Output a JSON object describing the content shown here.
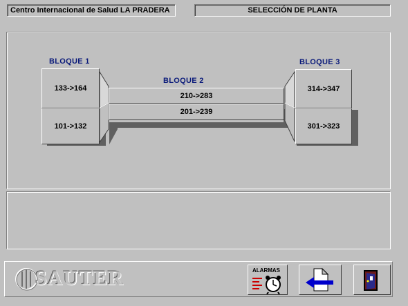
{
  "header": {
    "site_title": "Centro Internacional de Salud  LA PRADERA",
    "screen_title": "SELECCIÓN DE PLANTA"
  },
  "blocks": {
    "bloque1": {
      "title": "BLOQUE 1",
      "upper": "133->164",
      "lower": "101->132"
    },
    "bloque2": {
      "title": "BLOQUE 2",
      "upper": "210->283",
      "lower": "201->239"
    },
    "bloque3": {
      "title": "BLOQUE 3",
      "upper": "314->347",
      "lower": "301->323"
    }
  },
  "footer": {
    "brand": "SAUTER",
    "alarms_label": "ALARMAS",
    "icons": [
      "alarm-clock-icon",
      "back-arrow-icon",
      "exit-door-icon"
    ]
  },
  "colors": {
    "background": "#c0c0c0",
    "accent_text": "#0a1a7a",
    "arrow": "#0000cc"
  }
}
